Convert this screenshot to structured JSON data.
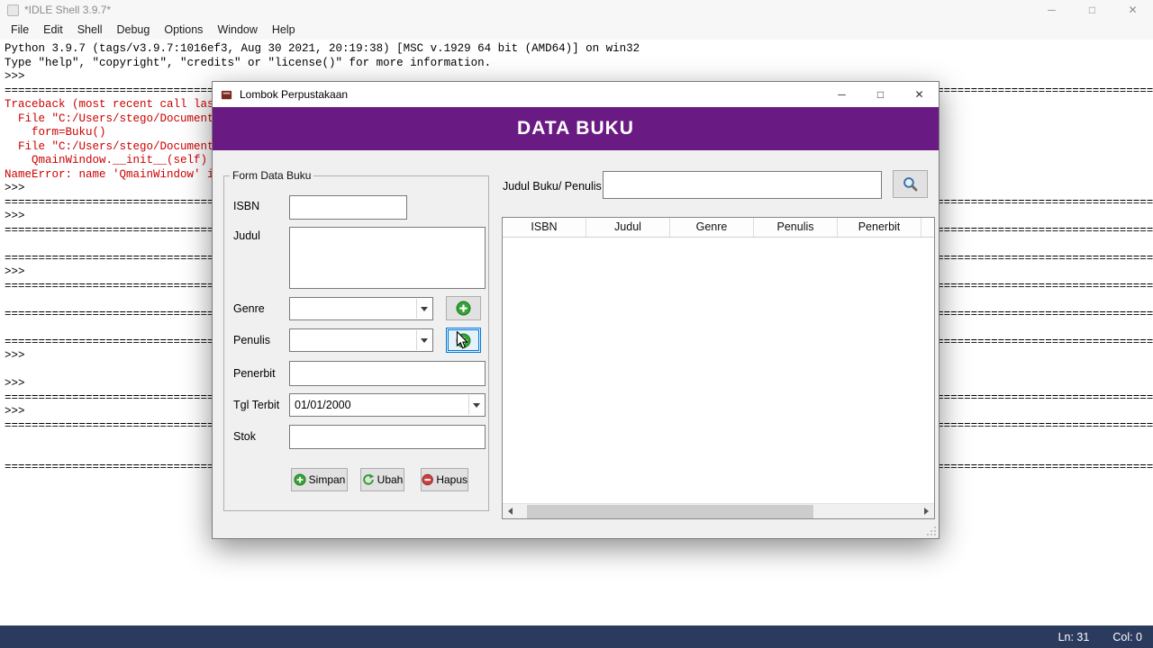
{
  "idle": {
    "title": "*IDLE Shell 3.9.7*",
    "menu": [
      "File",
      "Edit",
      "Shell",
      "Debug",
      "Options",
      "Window",
      "Help"
    ],
    "separator": "==========================================================================================================================================================================",
    "shell_lines": [
      {
        "kind": "out",
        "text": "Python 3.9.7 (tags/v3.9.7:1016ef3, Aug 30 2021, 20:19:38) [MSC v.1929 64 bit (AMD64)] on win32"
      },
      {
        "kind": "out",
        "text": "Type \"help\", \"copyright\", \"credits\" or \"license()\" for more information."
      },
      {
        "kind": "out",
        "text": ">>> "
      },
      {
        "kind": "sep",
        "text": ""
      },
      {
        "kind": "err",
        "text": "Traceback (most recent call last):"
      },
      {
        "kind": "err",
        "text": "  File \"C:/Users/stego/Documents/"
      },
      {
        "kind": "err",
        "text": "    form=Buku()"
      },
      {
        "kind": "err",
        "text": "  File \"C:/Users/stego/Documents/"
      },
      {
        "kind": "err",
        "text": "    QmainWindow.__init__(self)"
      },
      {
        "kind": "err",
        "text": "NameError: name 'QmainWindow' is not defined"
      },
      {
        "kind": "out",
        "text": ">>> "
      },
      {
        "kind": "sep",
        "text": ""
      },
      {
        "kind": "out",
        "text": ">>> "
      },
      {
        "kind": "sep",
        "text": ""
      },
      {
        "kind": "blank",
        "text": ""
      },
      {
        "kind": "sep",
        "text": ""
      },
      {
        "kind": "out",
        "text": ">>> "
      },
      {
        "kind": "sep",
        "text": ""
      },
      {
        "kind": "blank",
        "text": ""
      },
      {
        "kind": "sep",
        "text": ""
      },
      {
        "kind": "blank",
        "text": ""
      },
      {
        "kind": "sep",
        "text": ""
      },
      {
        "kind": "out",
        "text": ">>> "
      },
      {
        "kind": "blank",
        "text": ""
      },
      {
        "kind": "out",
        "text": ">>> "
      },
      {
        "kind": "sep",
        "text": ""
      },
      {
        "kind": "out",
        "text": ">>> "
      },
      {
        "kind": "sep",
        "text": ""
      },
      {
        "kind": "blank",
        "text": ""
      },
      {
        "kind": "blank",
        "text": ""
      },
      {
        "kind": "sep",
        "text": ""
      }
    ],
    "status": {
      "line": "Ln: 31",
      "col": "Col: 0"
    }
  },
  "window_controls": {
    "minimize": "─",
    "maximize": "□",
    "close": "✕"
  },
  "dialog": {
    "title": "Lombok Perpustakaan",
    "header_title": "DATA BUKU",
    "form": {
      "group_title": "Form Data Buku",
      "isbn": {
        "label": "ISBN",
        "value": ""
      },
      "judul": {
        "label": "Judul",
        "value": ""
      },
      "genre": {
        "label": "Genre",
        "value": ""
      },
      "penulis": {
        "label": "Penulis",
        "value": ""
      },
      "penerbit": {
        "label": "Penerbit",
        "value": ""
      },
      "tgl_terbit": {
        "label": "Tgl Terbit",
        "value": "01/01/2000"
      },
      "stok": {
        "label": "Stok",
        "value": ""
      },
      "buttons": {
        "simpan": "Simpan",
        "ubah": "Ubah",
        "hapus": "Hapus"
      }
    },
    "search": {
      "label": "Judul Buku/ Penulis",
      "value": ""
    },
    "table": {
      "headers": [
        "ISBN",
        "Judul",
        "Genre",
        "Penulis",
        "Penerbit"
      ],
      "rows": []
    }
  },
  "colors": {
    "header_purple": "#6a1b83",
    "error_red": "#cc0000",
    "status_bar_bg": "#2b3b5e",
    "focus_blue": "#0078d7",
    "accent_green": "#2f9e2f",
    "accent_red": "#c94040",
    "search_blue": "#3a6ea5"
  }
}
